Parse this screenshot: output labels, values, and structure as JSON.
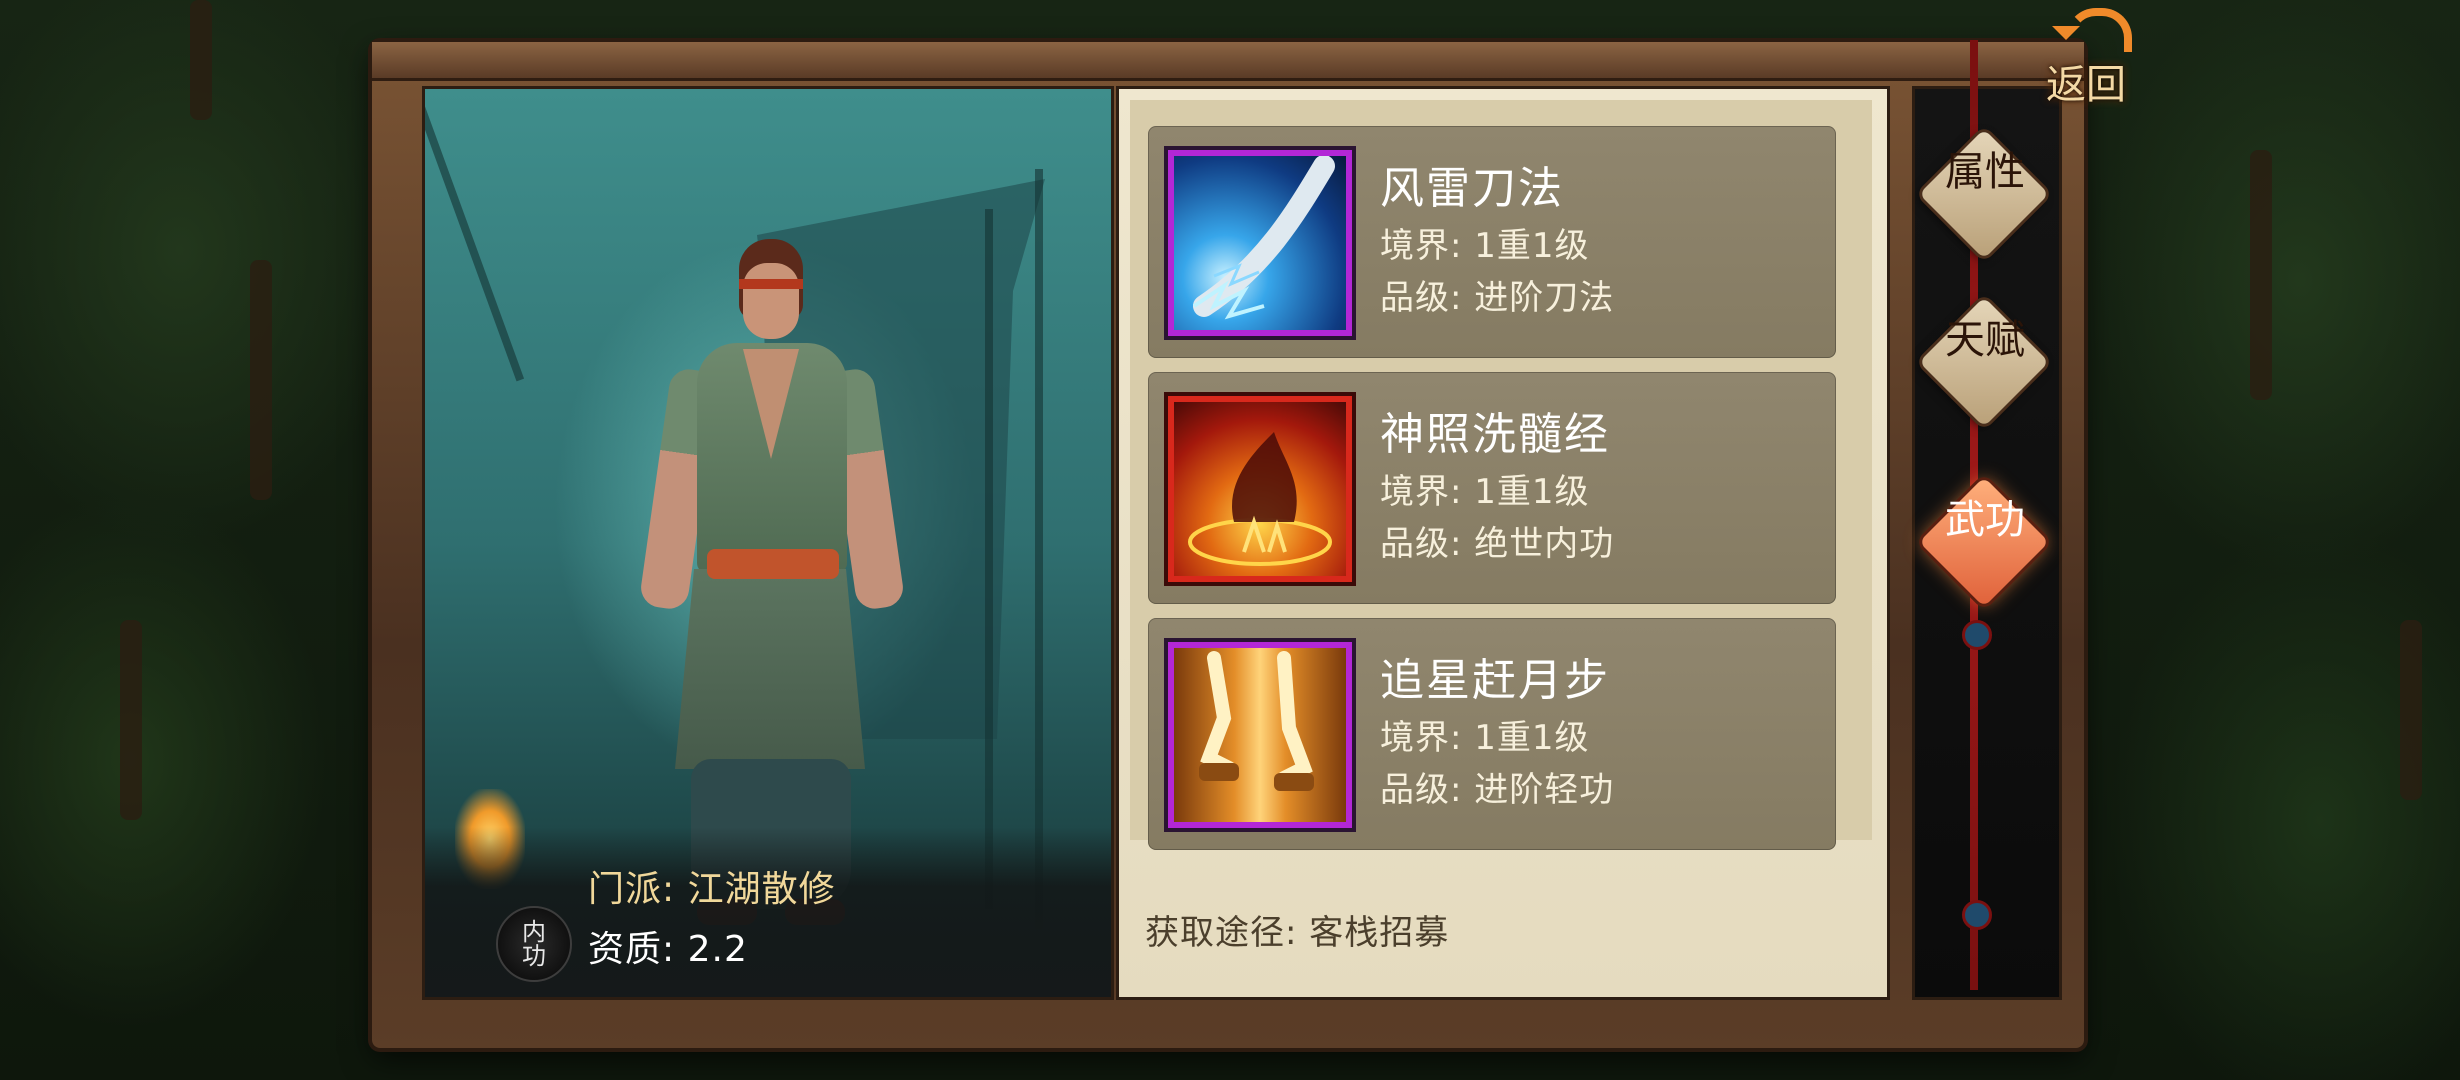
{
  "nav": {
    "back": "返回",
    "tabs": [
      "属性",
      "天赋",
      "武功"
    ],
    "active_tab": "武功",
    "accent_color": "#e0613a"
  },
  "character": {
    "badge": "内功",
    "sect_label": "门派:",
    "sect_value": "江湖散修",
    "aptitude_label": "资质:",
    "aptitude_value": "2.2"
  },
  "skills": [
    {
      "name": "风雷刀法",
      "realm_label": "境界:",
      "realm": "1重1级",
      "grade_label": "品级:",
      "grade": "进阶刀法",
      "icon": "lightning-blade-icon",
      "frame_color": "#b327d6"
    },
    {
      "name": "神照洗髓经",
      "realm_label": "境界:",
      "realm": "1重1级",
      "grade_label": "品级:",
      "grade": "绝世内功",
      "icon": "flame-meditation-icon",
      "frame_color": "#d8281c"
    },
    {
      "name": "追星赶月步",
      "realm_label": "境界:",
      "realm": "1重1级",
      "grade_label": "品级:",
      "grade": "进阶轻功",
      "icon": "golden-steps-icon",
      "frame_color": "#b327d6"
    }
  ],
  "source": "获取途径: 客栈招募"
}
